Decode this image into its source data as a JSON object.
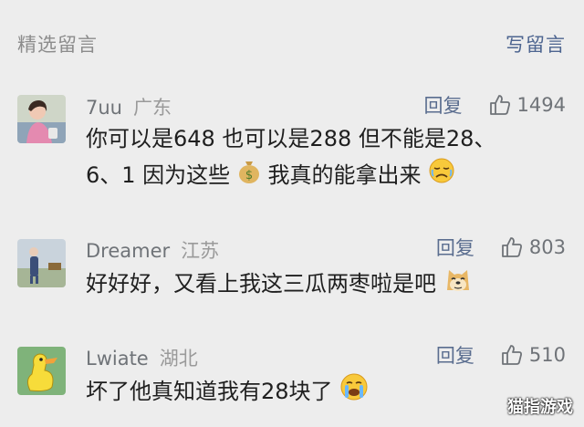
{
  "header": {
    "title": "精选留言",
    "write_label": "写留言"
  },
  "comments": [
    {
      "name": "7uu",
      "location": "广东",
      "reply_label": "回复",
      "likes": "1494",
      "text_line1": "你可以是648 也可以是288 但不能是28、",
      "text_line2a": "6、1 因为这些",
      "text_line2b": "我真的能拿出来",
      "emoji_1": "money-bag-icon",
      "emoji_2": "crying-face-icon"
    },
    {
      "name": "Dreamer",
      "location": "江苏",
      "reply_label": "回复",
      "likes": "803",
      "text": "好好好，又看上我这三瓜两枣啦是吧",
      "emoji_1": "doge-icon"
    },
    {
      "name": "Lwiate",
      "location": "湖北",
      "reply_label": "回复",
      "likes": "510",
      "text": "坏了他真知道我有28块了",
      "emoji_1": "crying-face-icon"
    }
  ],
  "watermark": "猫指游戏",
  "colors": {
    "background": "#ededed",
    "link": "#4d6590",
    "meta": "#6f7378"
  }
}
